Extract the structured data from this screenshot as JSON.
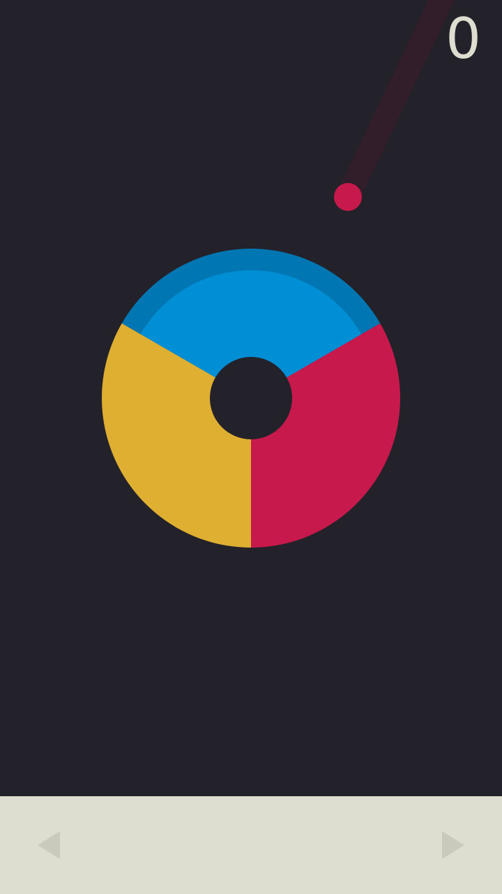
{
  "score": "0",
  "colors": {
    "background": "#23212a",
    "controls_bar": "#dddecf",
    "arrow": "#c9cabc",
    "score_text": "#dddecf",
    "blue": "#008fd5",
    "blue_shade": "#0076b3",
    "red": "#c8194d",
    "yellow": "#deaf30",
    "trail": "#321e2b",
    "hub": "#23212a"
  },
  "wheel": {
    "segments": [
      {
        "name": "blue",
        "color_key": "blue"
      },
      {
        "name": "red",
        "color_key": "red"
      },
      {
        "name": "yellow",
        "color_key": "yellow"
      }
    ]
  },
  "ball": {
    "color_key": "red"
  },
  "controls": {
    "left_icon": "triangle-left-icon",
    "right_icon": "triangle-right-icon"
  }
}
